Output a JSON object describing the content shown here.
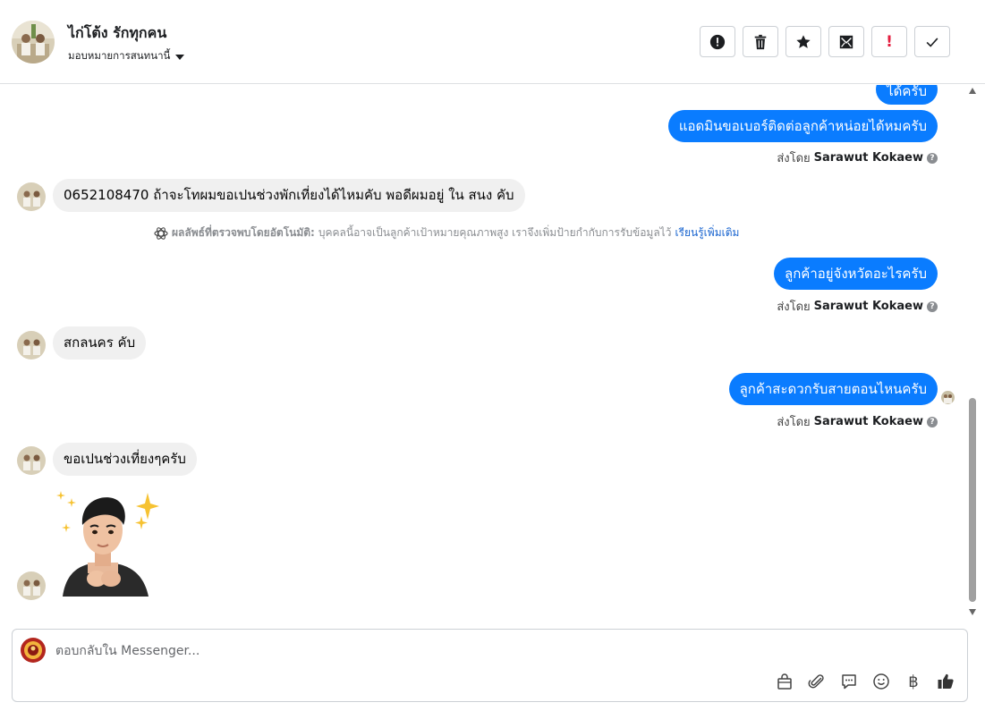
{
  "header": {
    "contact_name": "ไก่โต้ง รักทุกคน",
    "assign_label": "มอบหมายการสนทนานี้"
  },
  "toolbar": {
    "icons": [
      "alert-circle-icon",
      "trash-icon",
      "star-icon",
      "mail-icon",
      "exclamation-icon",
      "check-icon"
    ],
    "bang": "!"
  },
  "messages": {
    "out_1": "ได้ครับ",
    "out_2": "แอดมินขอเบอร์ติดต่อลูกค้าหน่อยได้หมครับ",
    "in_1": "0652108470 ถ้าจะโทผมขอเปนช่วงพักเที่ยงได้ไหมคับ พอดีผมอยู่ ใน สนง คับ",
    "out_3": "ลูกค้าอยู่จังหวัดอะไรครับ",
    "in_2": "สกลนคร คับ",
    "out_4": "ลูกค้าสะดวกรับสายตอนไหนครับ",
    "in_3": "ขอเปนช่วงเที่ยงๆครับ"
  },
  "sent_by": {
    "prefix": "ส่งโดย",
    "name": "Sarawut Kokaew",
    "info": "?"
  },
  "auto_note": {
    "label": "ผลลัพธ์ที่ตรวจพบโดยอัตโนมัติ:",
    "text": "บุคคลนี้อาจเป็นลูกค้าเป้าหมายคุณภาพสูง เราจึงเพิ่มป้ายกำกับการรับข้อมูลไว้",
    "link": "เรียนรู้เพิ่มเติม"
  },
  "composer": {
    "placeholder": "ตอบกลับใน Messenger...",
    "baht": "฿",
    "tools": [
      "shopping-bag-icon",
      "paperclip-icon",
      "chat-bubble-icon",
      "smiley-icon",
      "baht-icon",
      "thumbs-up-icon"
    ]
  },
  "colors": {
    "outgoing_bubble": "#0a7cff",
    "incoming_bubble": "#f0f0f0",
    "link": "#1763cf",
    "alert_red": "#e41e3f"
  }
}
